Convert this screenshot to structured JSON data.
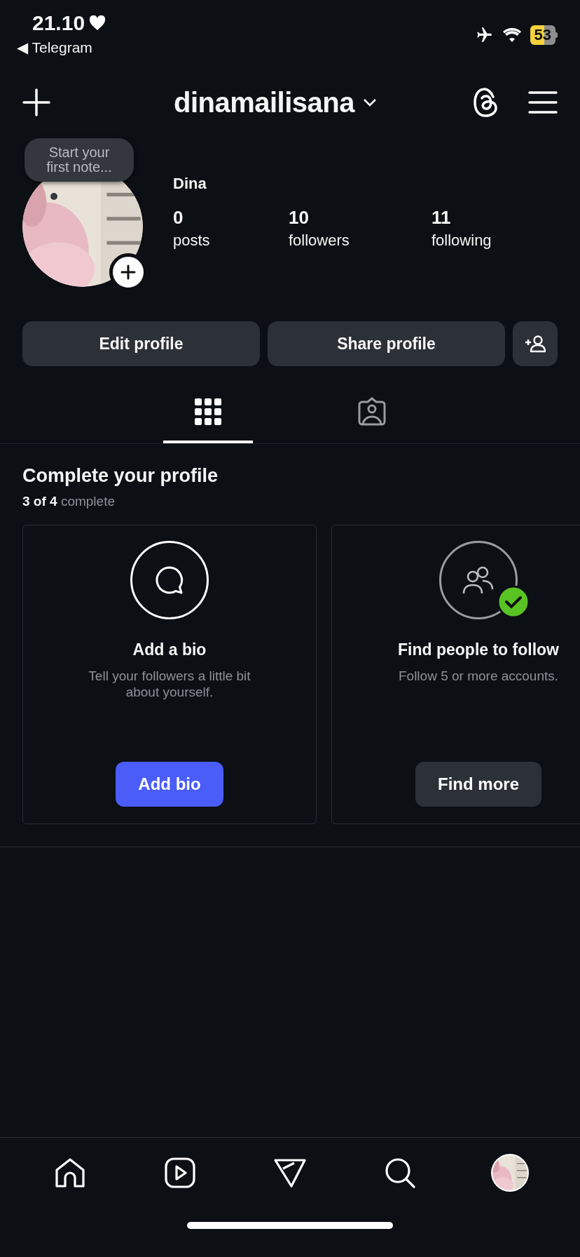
{
  "status_bar": {
    "time": "21.10",
    "back_app": "◀ Telegram",
    "battery": "53"
  },
  "header": {
    "username": "dinamailisana"
  },
  "profile": {
    "note": "Start your first note...",
    "name": "Dina",
    "stats": [
      {
        "value": "0",
        "label": "posts"
      },
      {
        "value": "10",
        "label": "followers"
      },
      {
        "value": "11",
        "label": "following"
      }
    ]
  },
  "actions": [
    "Edit profile",
    "Share profile"
  ],
  "tabs": [
    {
      "kind": "grid",
      "selected": true
    },
    {
      "kind": "tagged",
      "selected": false
    }
  ],
  "completion": {
    "title": "Complete your profile",
    "progress": "**3 of 4** complete",
    "cards": [
      {
        "kind": "bio",
        "completed": false,
        "title": "Add a bio",
        "description": "Tell your followers a little bit about yourself.",
        "button": "Add bio"
      },
      {
        "kind": "follow",
        "completed": true,
        "title": "Find people to follow",
        "description": "Follow 5 or more accounts.",
        "button": "Find more"
      }
    ]
  },
  "nav": [
    {
      "kind": "home"
    },
    {
      "kind": "reels"
    },
    {
      "kind": "messages"
    },
    {
      "kind": "search"
    },
    {
      "kind": "profile"
    }
  ]
}
